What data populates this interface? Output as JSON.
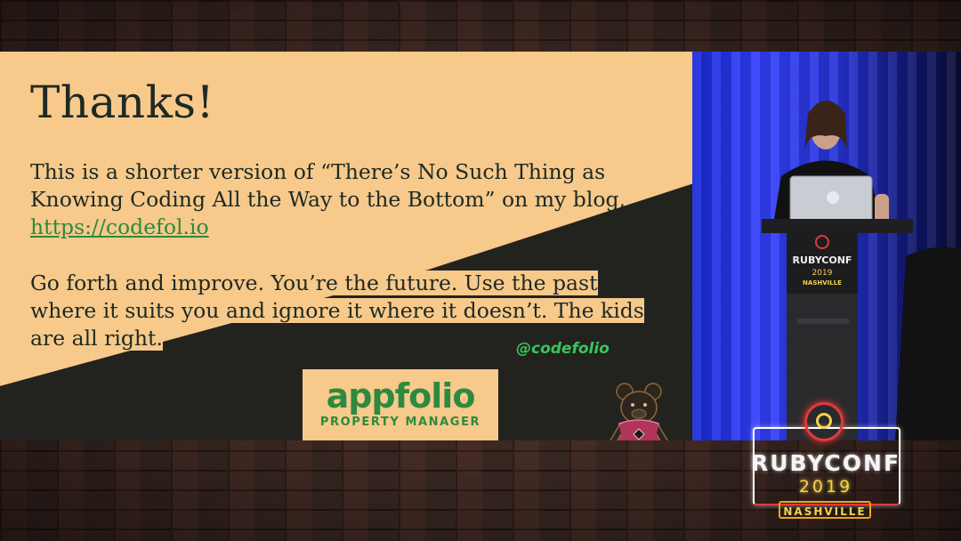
{
  "slide": {
    "title": "Thanks!",
    "para1_text": "This is a shorter version of “There’s No Such Thing as Knowing Coding All the Way to the Bottom” on my blog, ",
    "blog_link": "https://codefol.io",
    "para2_text": "Go forth and improve. You’re the future. Use the past where it suits you and ignore it where it doesn’t. The kids are all right.",
    "handle": "@codefolio",
    "sponsor_logo": "appfolio",
    "sponsor_tagline": "PROPERTY MANAGER"
  },
  "camera": {
    "podium_brand": "RUBYCONF",
    "podium_year": "2019",
    "podium_city": "NASHVILLE"
  },
  "overlay": {
    "brand": "RUBYCONF",
    "year": "2019",
    "city": "NASHVILLE"
  },
  "colors": {
    "slide_bg": "#f7c98b",
    "slide_dark": "#22231e",
    "accent_green": "#2d8a3e",
    "handle_green": "#39c55b",
    "stage_blue": "#2633d6"
  }
}
